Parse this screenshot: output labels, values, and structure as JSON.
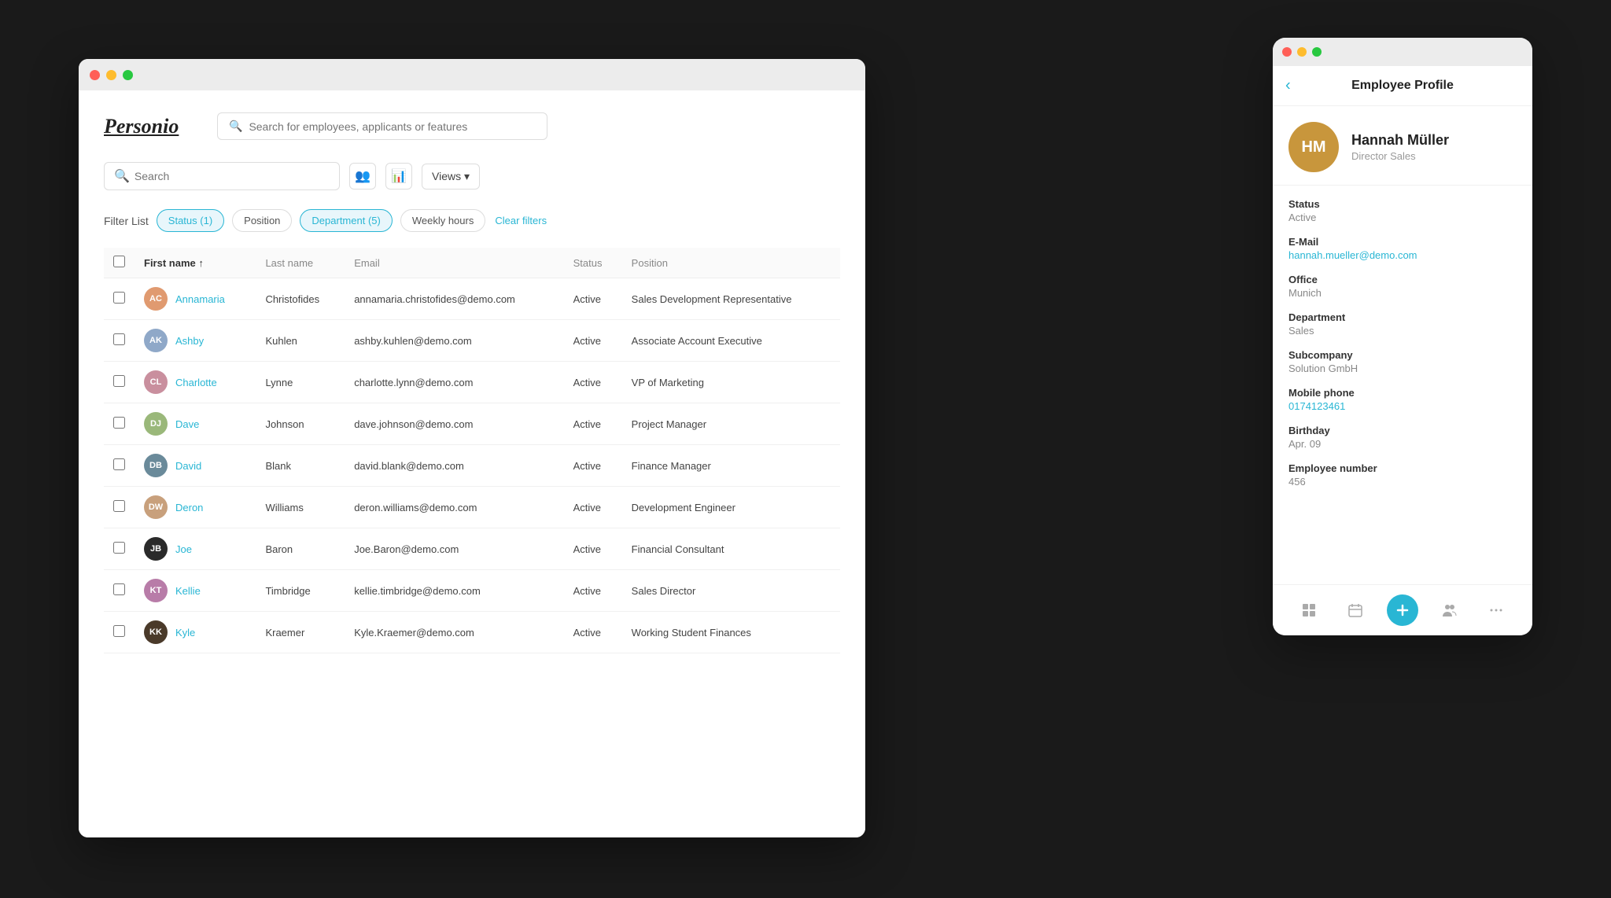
{
  "app": {
    "logo": "Personio",
    "global_search_placeholder": "Search for employees, applicants or features"
  },
  "toolbar": {
    "search_placeholder": "Search",
    "views_label": "Views ▾"
  },
  "filters": {
    "label": "Filter List",
    "chips": [
      {
        "id": "status",
        "label": "Status (1)",
        "active": true
      },
      {
        "id": "position",
        "label": "Position",
        "active": false
      },
      {
        "id": "department",
        "label": "Department (5)",
        "active": true
      },
      {
        "id": "weekly_hours",
        "label": "Weekly hours",
        "active": false
      }
    ],
    "clear_label": "Clear filters"
  },
  "table": {
    "columns": [
      "",
      "First name ↑",
      "Last name",
      "Email",
      "Status",
      "Position"
    ],
    "rows": [
      {
        "id": 1,
        "first": "Annamaria",
        "last": "Christofides",
        "email": "annamaria.christofides@demo.com",
        "status": "Active",
        "position": "Sales Development Representative",
        "avatar_color": "#e09a70",
        "initials": "AC"
      },
      {
        "id": 2,
        "first": "Ashby",
        "last": "Kuhlen",
        "email": "ashby.kuhlen@demo.com",
        "status": "Active",
        "position": "Associate Account Executive",
        "avatar_color": "#8fa8c8",
        "initials": "AK"
      },
      {
        "id": 3,
        "first": "Charlotte",
        "last": "Lynne",
        "email": "charlotte.lynn@demo.com",
        "status": "Active",
        "position": "VP of Marketing",
        "avatar_color": "#c98f9e",
        "initials": "CL"
      },
      {
        "id": 4,
        "first": "Dave",
        "last": "Johnson",
        "email": "dave.johnson@demo.com",
        "status": "Active",
        "position": "Project Manager",
        "avatar_color": "#9ab87a",
        "initials": "DJ"
      },
      {
        "id": 5,
        "first": "David",
        "last": "Blank",
        "email": "david.blank@demo.com",
        "status": "Active",
        "position": "Finance Manager",
        "avatar_color": "#6a8a9a",
        "initials": "DB"
      },
      {
        "id": 6,
        "first": "Deron",
        "last": "Williams",
        "email": "deron.williams@demo.com",
        "status": "Active",
        "position": "Development Engineer",
        "avatar_color": "#c8a07c",
        "initials": "DW"
      },
      {
        "id": 7,
        "first": "Joe",
        "last": "Baron",
        "email": "Joe.Baron@demo.com",
        "status": "Active",
        "position": "Financial Consultant",
        "avatar_color": "#2a2a2a",
        "initials": "JB"
      },
      {
        "id": 8,
        "first": "Kellie",
        "last": "Timbridge",
        "email": "kellie.timbridge@demo.com",
        "status": "Active",
        "position": "Sales Director",
        "avatar_color": "#b87ca8",
        "initials": "KT"
      },
      {
        "id": 9,
        "first": "Kyle",
        "last": "Kraemer",
        "email": "Kyle.Kraemer@demo.com",
        "status": "Active",
        "position": "Working Student Finances",
        "avatar_color": "#4a3a2a",
        "initials": "KK"
      }
    ]
  },
  "profile": {
    "title": "Employee Profile",
    "name": "Hannah Müller",
    "job_title": "Director Sales",
    "avatar_color": "#c8963c",
    "initials": "HM",
    "fields": [
      {
        "label": "Status",
        "value": "Active",
        "is_link": false
      },
      {
        "label": "E-Mail",
        "value": "hannah.mueller@demo.com",
        "is_link": true
      },
      {
        "label": "Office",
        "value": "Munich",
        "is_link": false
      },
      {
        "label": "Department",
        "value": "Sales",
        "is_link": false
      },
      {
        "label": "Subcompany",
        "value": "Solution GmbH",
        "is_link": false
      },
      {
        "label": "Mobile phone",
        "value": "0174123461",
        "is_link": true
      },
      {
        "label": "Birthday",
        "value": "Apr. 09",
        "is_link": false
      },
      {
        "label": "Employee number",
        "value": "456",
        "is_link": false
      }
    ],
    "bottom_nav": [
      {
        "icon": "⊞",
        "label": "grid-icon"
      },
      {
        "icon": "📅",
        "label": "calendar-icon"
      },
      {
        "icon": "+",
        "label": "add-icon",
        "active": true
      },
      {
        "icon": "👥",
        "label": "people-icon"
      },
      {
        "icon": "⋯",
        "label": "more-icon"
      }
    ]
  }
}
